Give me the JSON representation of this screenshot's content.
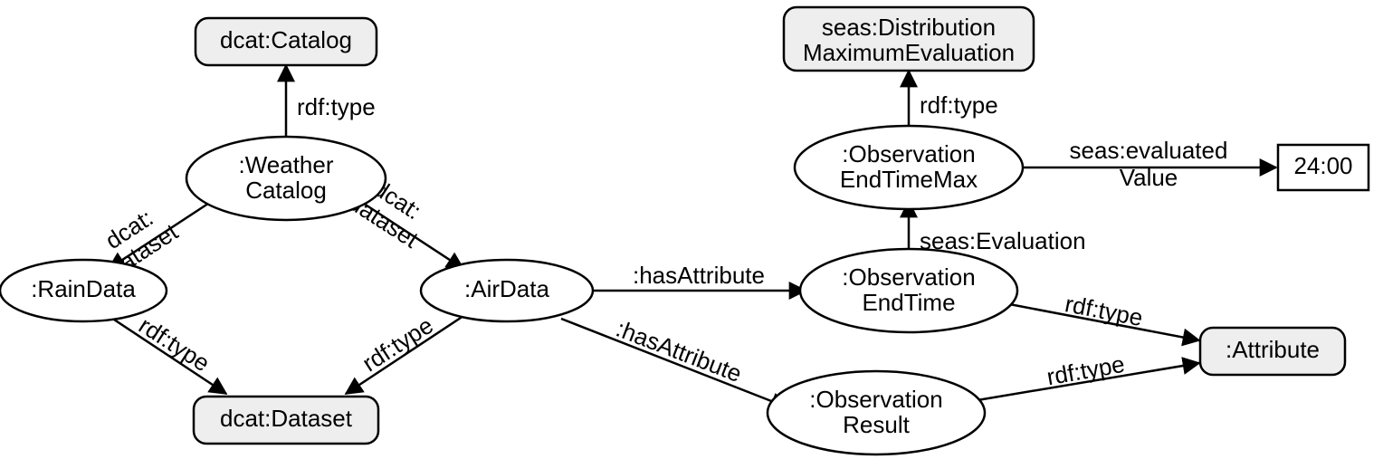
{
  "nodes": {
    "dcat_catalog": {
      "label_lines": [
        "dcat:Catalog"
      ]
    },
    "weather_catalog": {
      "label_lines": [
        ":Weather",
        "Catalog"
      ]
    },
    "rain_data": {
      "label_lines": [
        ":RainData"
      ]
    },
    "air_data": {
      "label_lines": [
        ":AirData"
      ]
    },
    "dcat_dataset": {
      "label_lines": [
        "dcat:Dataset"
      ]
    },
    "seas_dist_max_eval": {
      "label_lines": [
        "seas:Distribution",
        "MaximumEvaluation"
      ]
    },
    "obs_end_time_max": {
      "label_lines": [
        ":Observation",
        "EndTimeMax"
      ]
    },
    "obs_end_time": {
      "label_lines": [
        ":Observation",
        "EndTime"
      ]
    },
    "obs_result": {
      "label_lines": [
        ":Observation",
        "Result"
      ]
    },
    "attribute": {
      "label_lines": [
        ":Attribute"
      ]
    },
    "literal_2400": {
      "label_lines": [
        "24:00"
      ]
    }
  },
  "edges": {
    "wc_type": {
      "label_lines": [
        "rdf:type"
      ]
    },
    "wc_rain": {
      "label_lines": [
        "dcat:",
        "dataset"
      ]
    },
    "wc_air": {
      "label_lines": [
        "dcat:",
        "dataset"
      ]
    },
    "rain_type": {
      "label_lines": [
        "rdf:type"
      ]
    },
    "air_type": {
      "label_lines": [
        "rdf:type"
      ]
    },
    "air_has_endtime": {
      "label_lines": [
        ":hasAttribute"
      ]
    },
    "air_has_result": {
      "label_lines": [
        ":hasAttribute"
      ]
    },
    "etmax_type": {
      "label_lines": [
        "rdf:type"
      ]
    },
    "etmax_value": {
      "label_lines": [
        "seas:evaluated",
        "Value"
      ]
    },
    "et_eval": {
      "label_lines": [
        "seas:Evaluation"
      ]
    },
    "et_type": {
      "label_lines": [
        "rdf:type"
      ]
    },
    "result_type": {
      "label_lines": [
        "rdf:type"
      ]
    }
  }
}
